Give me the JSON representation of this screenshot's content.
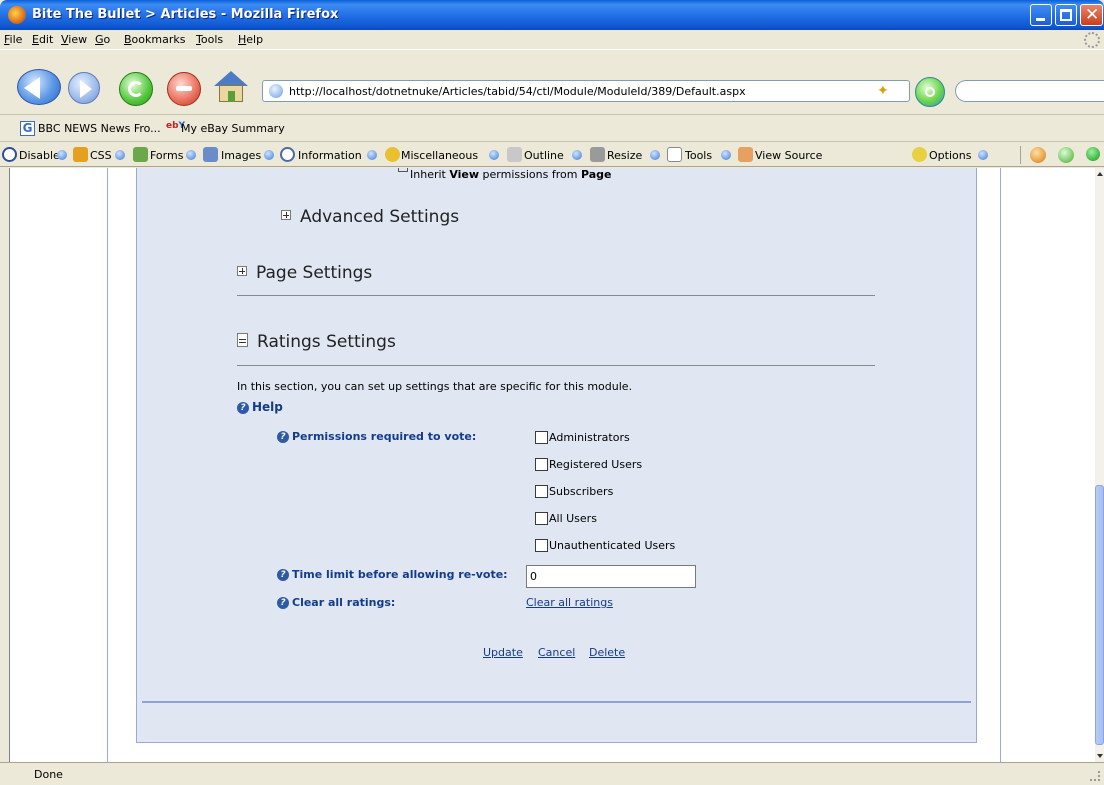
{
  "window": {
    "title": "Bite The Bullet > Articles - Mozilla Firefox"
  },
  "menu": {
    "items": [
      {
        "pre": "",
        "key": "F",
        "post": "ile"
      },
      {
        "pre": "",
        "key": "E",
        "post": "dit"
      },
      {
        "pre": "",
        "key": "V",
        "post": "iew"
      },
      {
        "pre": "",
        "key": "G",
        "post": "o"
      },
      {
        "pre": "",
        "key": "B",
        "post": "ookmarks"
      },
      {
        "pre": "",
        "key": "T",
        "post": "ools"
      },
      {
        "pre": "",
        "key": "H",
        "post": "elp"
      }
    ]
  },
  "nav": {
    "url": "http://localhost/dotnetnuke/Articles/tabid/54/ctl/Module/ModuleId/389/Default.aspx",
    "search_value": ""
  },
  "bookmarks": {
    "items": [
      "BBC NEWS  News Fro...",
      "My eBay Summary"
    ]
  },
  "devtoolbar": {
    "items": [
      "Disable",
      "CSS",
      "Forms",
      "Images",
      "Information",
      "Miscellaneous",
      "Outline",
      "Resize",
      "Tools",
      "View Source",
      "Options"
    ]
  },
  "page": {
    "inherit_pre": "Inherit ",
    "inherit_view": "View",
    "inherit_mid": " permissions from ",
    "inherit_page": "Page",
    "advanced_settings": "Advanced Settings",
    "page_settings": "Page Settings",
    "ratings_settings": "Ratings Settings",
    "description": "In this section, you can set up settings that are specific for this module.",
    "help": "Help",
    "permissions_label": "Permissions required to vote:",
    "roles": [
      "Administrators",
      "Registered Users",
      "Subscribers",
      "All Users",
      "Unauthenticated Users"
    ],
    "time_limit_label": "Time limit before allowing re-vote:",
    "time_limit_value": "0",
    "clear_label": "Clear all ratings:",
    "clear_link": "Clear all ratings",
    "actions": {
      "update": "Update",
      "cancel": "Cancel",
      "delete": "Delete"
    }
  },
  "status": {
    "text": "Done"
  }
}
